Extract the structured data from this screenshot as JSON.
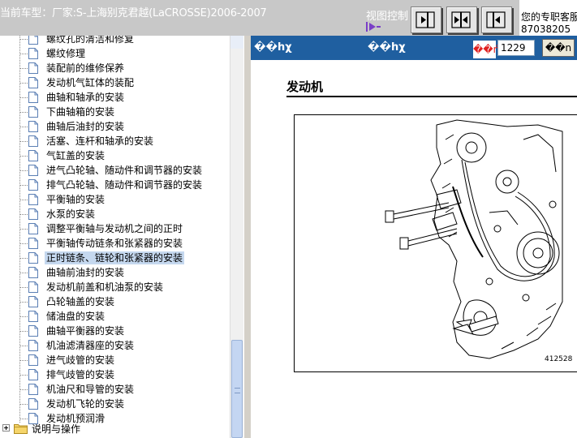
{
  "header": {
    "car_title": "当前车型：厂家:S-上海别克君越(LaCROSSE)2006-2007",
    "view_control_label": "视图控制",
    "right_line1": "您的专职客服",
    "right_line2": "87038205"
  },
  "tree": {
    "items": [
      {
        "label": "螺纹孔的清洁和修复"
      },
      {
        "label": "螺纹修理"
      },
      {
        "label": "装配前的维修保养"
      },
      {
        "label": "发动机气缸体的装配"
      },
      {
        "label": "曲轴和轴承的安装"
      },
      {
        "label": "下曲轴箱的安装"
      },
      {
        "label": "曲轴后油封的安装"
      },
      {
        "label": "活塞、连杆和轴承的安装"
      },
      {
        "label": "气缸盖的安装"
      },
      {
        "label": "进气凸轮轴、随动件和调节器的安装"
      },
      {
        "label": "排气凸轮轴、随动件和调节器的安装"
      },
      {
        "label": "平衡轴的安装"
      },
      {
        "label": "水泵的安装"
      },
      {
        "label": "调整平衡轴与发动机之间的正时"
      },
      {
        "label": "平衡轴传动链条和张紧器的安装"
      },
      {
        "label": "正时链条、链轮和张紧器的安装",
        "selected": true
      },
      {
        "label": "曲轴前油封的安装"
      },
      {
        "label": "发动机前盖和机油泵的安装"
      },
      {
        "label": "凸轮轴盖的安装"
      },
      {
        "label": "储油盘的安装"
      },
      {
        "label": "曲轴平衡器的安装"
      },
      {
        "label": "机油滤清器座的安装"
      },
      {
        "label": "进气歧管的安装"
      },
      {
        "label": "排气歧管的安装"
      },
      {
        "label": "机油尺和导管的安装"
      },
      {
        "label": "发动机飞轮的安装"
      },
      {
        "label": "发动机预润滑"
      }
    ],
    "folder_label": "说明与操作"
  },
  "content": {
    "bar_left_label": "��hχ",
    "bar_mid_label": "��hχ",
    "page_label": "��ή",
    "page_value": "1229",
    "go_label": "��n",
    "section_title": "发动机",
    "figure_number": "412528"
  },
  "colors": {
    "header_bg": "#c8c8c8",
    "content_bar_bg": "#1f5fa0",
    "selected_bg": "#c5d8ef",
    "page_label_color": "#e0201f"
  },
  "icons": {
    "doc": "document-icon",
    "folder": "folder-icon",
    "expand": "expand-plus-icon"
  }
}
